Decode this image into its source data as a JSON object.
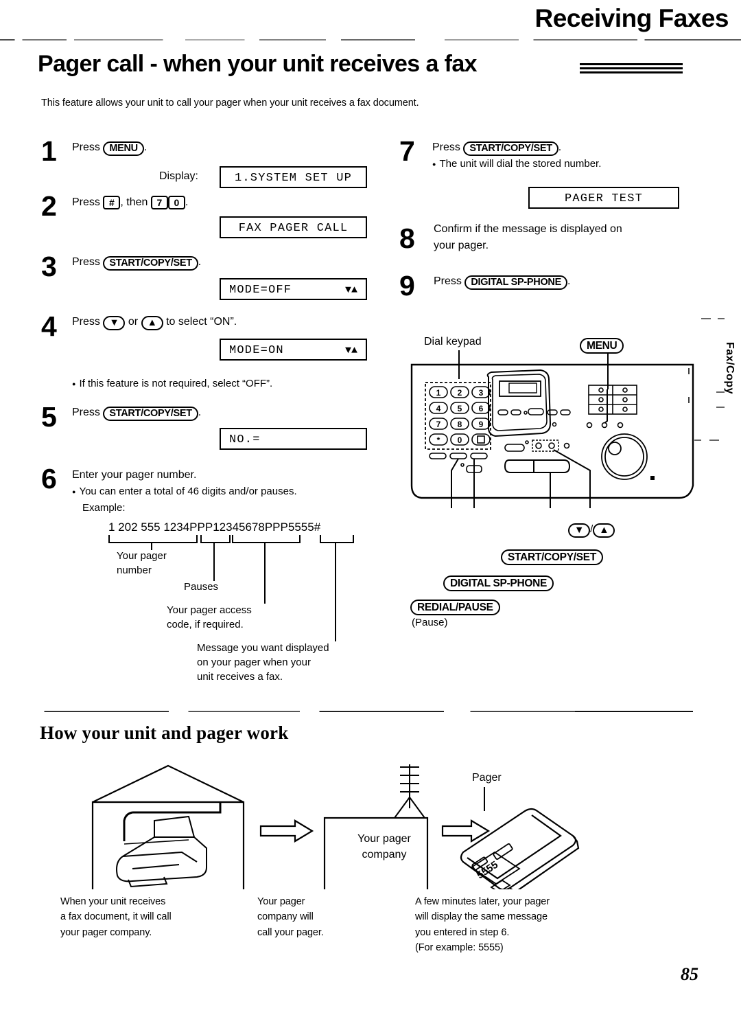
{
  "header": {
    "chapter_title": "Receiving Faxes",
    "page_title": "Pager call - when your unit receives a fax",
    "intro": "This feature allows your unit to call your pager when your unit receives a fax document.",
    "side_tab": "Fax/Copy",
    "page_number": "85"
  },
  "steps": {
    "s1": {
      "num": "1",
      "text_pre": "Press",
      "key": "MENU",
      "text_post": "."
    },
    "s1_display_label": "Display:",
    "s1_lcd": "1.SYSTEM SET UP",
    "s2": {
      "num": "2",
      "text_pre": "Press",
      "key1": "#",
      "text_mid": ", then",
      "key2": "7",
      "key3": "0",
      "text_post": "."
    },
    "s2_lcd": "FAX PAGER CALL",
    "s3": {
      "num": "3",
      "text_pre": "Press",
      "key": "START/COPY/SET",
      "text_post": "."
    },
    "s3_lcd": "MODE=OFF",
    "s3_lcd_arrows": "▼▲",
    "s4": {
      "num": "4",
      "text_pre": "Press",
      "key1": "▼",
      "text_mid": "or",
      "key2": "▲",
      "text_post": "to select “ON”."
    },
    "s4_lcd": "MODE=ON",
    "s4_lcd_arrows": "▼▲",
    "s4_note": "If this feature is not required, select “OFF”.",
    "s5": {
      "num": "5",
      "text_pre": "Press",
      "key": "START/COPY/SET",
      "text_post": "."
    },
    "s5_lcd": "NO.=",
    "s6": {
      "num": "6",
      "line1": "Enter your pager number.",
      "bullet": "You can enter a total of 46 digits and/or pauses.",
      "example_label": "Example:"
    },
    "s7": {
      "num": "7",
      "text_pre": "Press",
      "key": "START/COPY/SET",
      "text_post": ".",
      "bullet": "The unit will dial the stored number."
    },
    "s7_lcd": "PAGER TEST",
    "s8": {
      "num": "8",
      "line1": "Confirm if the message is displayed on",
      "line2": "your pager."
    },
    "s9": {
      "num": "9",
      "text_pre": "Press",
      "key": "DIGITAL SP-PHONE",
      "text_post": "."
    }
  },
  "example": {
    "number_parts": {
      "pager_number": "1 202 555 1234",
      "pause1": "PPP",
      "access_code": "12345678",
      "pause2": "PPP",
      "message": "5555",
      "terminator": "#"
    },
    "full_string": "1 202 555 1234PPP12345678PPP5555#",
    "callouts": {
      "pager_number": "Your pager\nnumber",
      "pager_number_l1": "Your pager",
      "pager_number_l2": "number",
      "pauses": "Pauses",
      "access_code_l1": "Your pager access",
      "access_code_l2": "code, if required.",
      "message_l1": "Message you want displayed",
      "message_l2": "on your pager when your",
      "message_l3": "unit receives a fax."
    }
  },
  "unit_diagram": {
    "dial_keypad_label": "Dial keypad",
    "menu_label": "MENU",
    "keypad_rows": [
      [
        "1",
        "2",
        "3"
      ],
      [
        "4",
        "5",
        "6"
      ],
      [
        "7",
        "8",
        "9"
      ],
      [
        "*",
        "0",
        "□"
      ]
    ],
    "arrow_down_label": "▼",
    "arrow_up_label": "▲",
    "arrow_sep": "/",
    "start_copy_set_label": "START/COPY/SET",
    "digital_sp_phone_label": "DIGITAL SP-PHONE",
    "redial_pause_label": "REDIAL/PAUSE",
    "redial_pause_sub": "(Pause)"
  },
  "section2": {
    "title": "How your unit and pager work",
    "pager_label": "Pager",
    "pager_display": "5555",
    "company_box_l1": "Your pager",
    "company_box_l2": "company",
    "captions": [
      {
        "l1": "When your unit receives",
        "l2": "a fax document, it will call",
        "l3": "your pager company.",
        "l4": ""
      },
      {
        "l1": "Your pager",
        "l2": "company will",
        "l3": "call your pager.",
        "l4": ""
      },
      {
        "l1": "A few minutes later, your pager",
        "l2": "will display the same message",
        "l3": "you entered in step 6.",
        "l4": "(For example: 5555)"
      }
    ]
  }
}
